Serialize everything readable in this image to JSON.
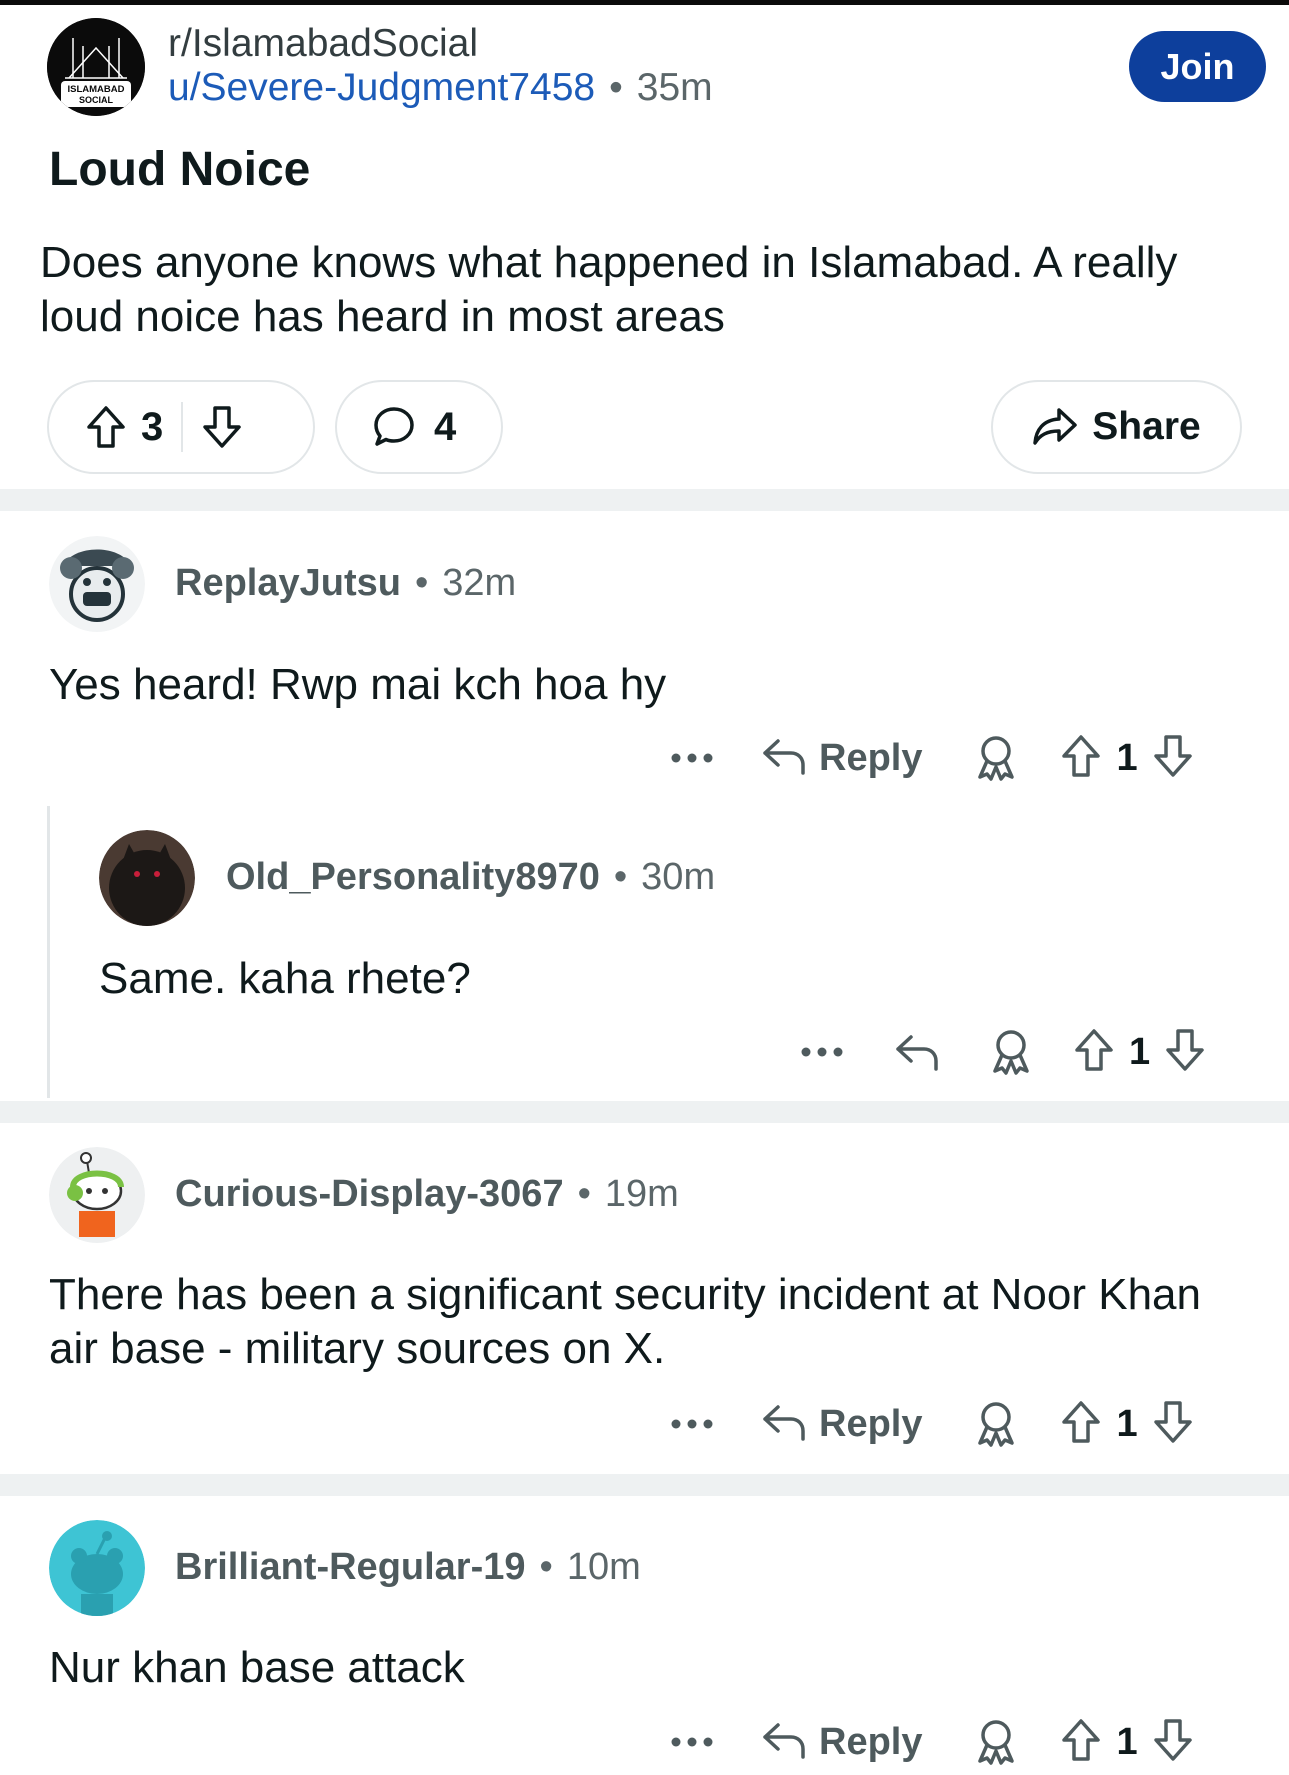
{
  "post": {
    "subreddit": "r/IslamabadSocial",
    "subreddit_logo_text_line1": "ISLAMABAD",
    "subreddit_logo_text_line2": "SOCIAL",
    "author": "u/Severe-Judgment7458",
    "time": "35m",
    "join_label": "Join",
    "title": "Loud Noice",
    "body": "Does anyone knows what happened in Islamabad. A really loud noice has heard in most areas",
    "upvotes": "3",
    "comments": "4",
    "share_label": "Share"
  },
  "comments": [
    {
      "user": "ReplayJutsu",
      "time": "32m",
      "body": "Yes heard! Rwp mai kch hoa hy",
      "reply_label": "Reply",
      "votes": "1"
    },
    {
      "user": "Old_Personality8970",
      "time": "30m",
      "body": "Same. kaha rhete?",
      "votes": "1"
    },
    {
      "user": "Curious-Display-3067",
      "time": "19m",
      "body": "There has been a significant security incident at Noor Khan air base - military sources on X.",
      "reply_label": "Reply",
      "votes": "1"
    },
    {
      "user": "Brilliant-Regular-19",
      "time": "10m",
      "body": "Nur khan base attack",
      "reply_label": "Reply",
      "votes": "1"
    }
  ],
  "colors": {
    "join_button": "#0d3f9c",
    "author_link": "#1c5bb8",
    "separator_band": "#eef1f2"
  },
  "icons": [
    "upvote-icon",
    "downvote-icon",
    "comment-icon",
    "share-icon",
    "more-icon",
    "reply-icon",
    "award-icon"
  ]
}
